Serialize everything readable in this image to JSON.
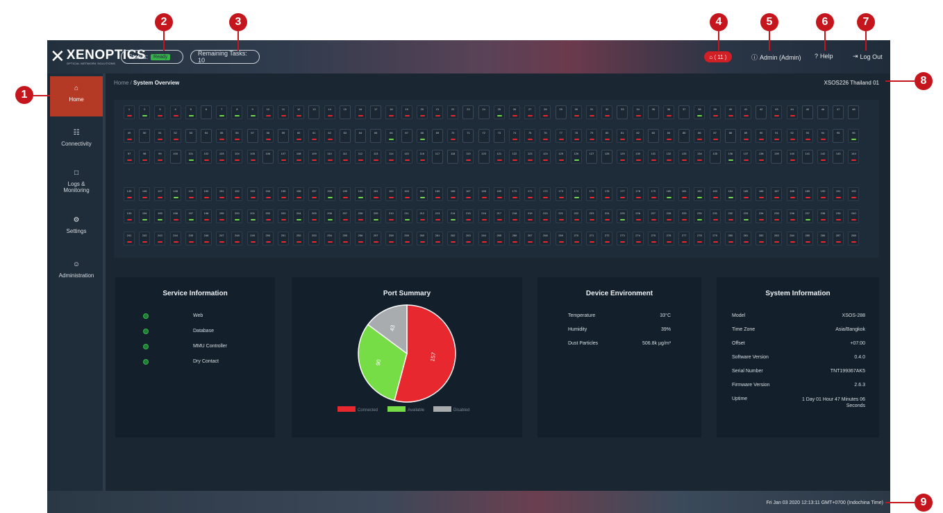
{
  "callouts": [
    "1",
    "2",
    "3",
    "4",
    "5",
    "6",
    "7",
    "8",
    "9"
  ],
  "brand": {
    "name": "XENOPTICS",
    "tagline": "OPTICAL NETWORK SOLUTIONS"
  },
  "header": {
    "status_label": "Status:",
    "status_value": "Ready",
    "remaining_tasks": "Remaining Tasks: 10",
    "notifications": "⌂ ( 11 )",
    "user": "Admin (Admin)",
    "help": "Help",
    "logout": "Log Out"
  },
  "sidebar": {
    "items": [
      {
        "label": "Home",
        "icon": "home-icon",
        "active": true
      },
      {
        "label": "Connectivity",
        "icon": "network-icon",
        "active": false
      },
      {
        "label": "Logs & Monitoring",
        "icon": "monitor-icon",
        "active": false
      },
      {
        "label": "Settings",
        "icon": "gear-icon",
        "active": false
      },
      {
        "label": "Administration",
        "icon": "users-icon",
        "active": false
      }
    ]
  },
  "breadcrumb": {
    "home": "Home",
    "separator": " / ",
    "current": "System Overview"
  },
  "device_name": "XSOS226 Thailand 01",
  "ports": {
    "rows": [
      {
        "start": 1,
        "states": [
          "c",
          "a",
          "c",
          "c",
          "a",
          "d",
          "a",
          "a",
          "a",
          "c",
          "c",
          "c",
          "d",
          "c",
          "d",
          "c",
          "d",
          "c",
          "c",
          "c",
          "c",
          "c",
          "d",
          "d",
          "a",
          "c",
          "c",
          "c",
          "d",
          "c",
          "c",
          "c",
          "d",
          "c",
          "d",
          "c",
          "d",
          "a",
          "c",
          "c",
          "c",
          "d",
          "c",
          "c",
          "d",
          "d",
          "d",
          "d"
        ]
      },
      {
        "start": 49,
        "states": [
          "c",
          "d",
          "c",
          "c",
          "d",
          "d",
          "c",
          "c",
          "d",
          "c",
          "d",
          "c",
          "c",
          "c",
          "d",
          "d",
          "d",
          "a",
          "d",
          "a",
          "d",
          "c",
          "d",
          "d",
          "d",
          "c",
          "c",
          "c",
          "c",
          "c",
          "c",
          "c",
          "c",
          "c",
          "d",
          "c",
          "d",
          "c",
          "c",
          "d",
          "c",
          "c",
          "c",
          "c",
          "c",
          "c",
          "d",
          "a"
        ]
      },
      {
        "start": 97,
        "states": [
          "c",
          "c",
          "c",
          "d",
          "a",
          "c",
          "c",
          "c",
          "c",
          "d",
          "c",
          "c",
          "c",
          "c",
          "c",
          "c",
          "c",
          "c",
          "c",
          "c",
          "d",
          "d",
          "c",
          "d",
          "c",
          "c",
          "c",
          "c",
          "c",
          "a",
          "d",
          "d",
          "c",
          "c",
          "c",
          "c",
          "c",
          "c",
          "d",
          "a",
          "c",
          "c",
          "d",
          "c",
          "d",
          "c",
          "d",
          "c"
        ]
      },
      {
        "start": 145,
        "states": [
          "c",
          "c",
          "c",
          "a",
          "c",
          "c",
          "c",
          "c",
          "c",
          "c",
          "c",
          "c",
          "c",
          "a",
          "c",
          "a",
          "c",
          "c",
          "c",
          "a",
          "c",
          "c",
          "c",
          "c",
          "c",
          "c",
          "c",
          "c",
          "c",
          "a",
          "c",
          "c",
          "c",
          "c",
          "c",
          "a",
          "c",
          "a",
          "c",
          "a",
          "c",
          "c",
          "c",
          "c",
          "c",
          "c",
          "c",
          "c"
        ]
      },
      {
        "start": 193,
        "states": [
          "c",
          "a",
          "a",
          "c",
          "a",
          "c",
          "c",
          "a",
          "a",
          "c",
          "c",
          "a",
          "c",
          "a",
          "c",
          "c",
          "a",
          "c",
          "a",
          "c",
          "c",
          "a",
          "c",
          "c",
          "c",
          "c",
          "c",
          "c",
          "c",
          "c",
          "c",
          "c",
          "a",
          "c",
          "c",
          "c",
          "c",
          "a",
          "c",
          "c",
          "a",
          "c",
          "c",
          "c",
          "a",
          "c",
          "c",
          "c"
        ]
      },
      {
        "start": 241,
        "states": [
          "c",
          "c",
          "c",
          "c",
          "c",
          "c",
          "c",
          "c",
          "c",
          "c",
          "c",
          "c",
          "c",
          "c",
          "c",
          "c",
          "c",
          "c",
          "c",
          "c",
          "c",
          "c",
          "c",
          "c",
          "c",
          "c",
          "c",
          "c",
          "c",
          "c",
          "c",
          "c",
          "c",
          "c",
          "c",
          "c",
          "c",
          "c",
          "c",
          "c",
          "c",
          "c",
          "c",
          "c",
          "c",
          "c",
          "c",
          "c"
        ]
      }
    ]
  },
  "service_information": {
    "title": "Service Information",
    "items": [
      "Web",
      "Database",
      "MMU Controller",
      "Dry Contact"
    ]
  },
  "port_summary": {
    "title": "Port Summary"
  },
  "chart_data": {
    "type": "pie",
    "title": "Port Summary",
    "categories": [
      "Connected",
      "Available",
      "Disabled"
    ],
    "values": [
      157,
      90,
      43
    ],
    "labels": [
      "157",
      "90",
      "43"
    ],
    "colors": [
      "#e8282f",
      "#77dd46",
      "#a9acae"
    ],
    "legend": "bottom"
  },
  "device_environment": {
    "title": "Device Environment",
    "rows": [
      {
        "label": "Temperature",
        "value": "33°C"
      },
      {
        "label": "Humidity",
        "value": "39%"
      },
      {
        "label": "Dust Particles",
        "value": "506.8k µg/m³"
      }
    ]
  },
  "system_information": {
    "title": "System Information",
    "rows": [
      {
        "label": "Model",
        "value": "XSOS-288"
      },
      {
        "label": "Time Zone",
        "value": "Asia/Bangkok"
      },
      {
        "label": "Offset",
        "value": "+07:00"
      },
      {
        "label": "Software Version",
        "value": "0.4.0"
      },
      {
        "label": "Serial Number",
        "value": "TNT199367AK5"
      },
      {
        "label": "Firmware Version",
        "value": "2.6.3"
      },
      {
        "label": "Uptime",
        "value": "1 Day 01 Hour 47 Minutes 06 Seconds"
      }
    ]
  },
  "footer": {
    "datetime": "Fri Jan 03 2020 12:13:11 GMT+0700 (Indochina Time)"
  }
}
